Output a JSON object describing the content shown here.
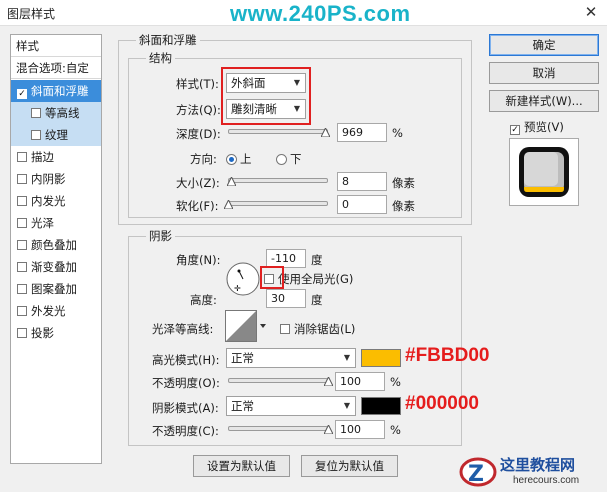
{
  "window": {
    "title": "图层样式",
    "watermark_top": "www.240PS.com",
    "close_glyph": "✕"
  },
  "left_panel": {
    "items": [
      {
        "label": "样式",
        "kind": "header"
      },
      {
        "label": "混合选项:自定",
        "kind": "header"
      },
      {
        "label": "斜面和浮雕",
        "checked": true,
        "kind": "selected"
      },
      {
        "label": "等高线",
        "checked": false,
        "kind": "sub"
      },
      {
        "label": "纹理",
        "checked": false,
        "kind": "sub"
      },
      {
        "label": "描边",
        "checked": false
      },
      {
        "label": "内阴影",
        "checked": false
      },
      {
        "label": "内发光",
        "checked": false
      },
      {
        "label": "光泽",
        "checked": false
      },
      {
        "label": "颜色叠加",
        "checked": false
      },
      {
        "label": "渐变叠加",
        "checked": false
      },
      {
        "label": "图案叠加",
        "checked": false
      },
      {
        "label": "外发光",
        "checked": false
      },
      {
        "label": "投影",
        "checked": false
      }
    ]
  },
  "bevel": {
    "section_title": "斜面和浮雕",
    "structure_title": "结构",
    "style_label": "样式(T):",
    "style_value": "外斜面",
    "technique_label": "方法(Q):",
    "technique_value": "雕刻清晰",
    "depth_label": "深度(D):",
    "depth_value": "969",
    "depth_unit": "%",
    "depth_fraction": 0.97,
    "direction_label": "方向:",
    "direction_up": "上",
    "direction_down": "下",
    "direction_selected": "上",
    "size_label": "大小(Z):",
    "size_value": "8",
    "size_unit": "像素",
    "size_fraction": 0.03,
    "soften_label": "软化(F):",
    "soften_value": "0",
    "soften_unit": "像素",
    "soften_fraction": 0.0
  },
  "shading": {
    "title": "阴影",
    "angle_label": "角度(N):",
    "angle_value": "-110",
    "angle_unit": "度",
    "global_light_label": "使用全局光(G)",
    "global_light_checked": false,
    "altitude_label": "高度:",
    "altitude_value": "30",
    "altitude_unit": "度",
    "gloss_contour_label": "光泽等高线:",
    "anti_alias_label": "消除锯齿(L)",
    "anti_alias_checked": false,
    "highlight_mode_label": "高光模式(H):",
    "highlight_mode_value": "正常",
    "highlight_color": "#FBBD00",
    "highlight_hex_label": "#FBBD00",
    "highlight_opacity_label": "不透明度(O):",
    "highlight_opacity_value": "100",
    "highlight_opacity_unit": "%",
    "highlight_opacity_fraction": 1.0,
    "shadow_mode_label": "阴影模式(A):",
    "shadow_mode_value": "正常",
    "shadow_color": "#000000",
    "shadow_hex_label": "#000000",
    "shadow_opacity_label": "不透明度(C):",
    "shadow_opacity_value": "100",
    "shadow_opacity_unit": "%",
    "shadow_opacity_fraction": 1.0
  },
  "bottom_buttons": {
    "make_default": "设置为默认值",
    "reset_default": "复位为默认值"
  },
  "right_buttons": {
    "ok": "确定",
    "cancel": "取消",
    "new_style": "新建样式(W)...",
    "preview_label": "预览(V)",
    "preview_checked": true
  },
  "watermark_bottom": {
    "title": "这里教程网",
    "url": "herecours.com"
  },
  "colors": {
    "accent_red": "#e02020",
    "selection_blue": "#3b8ddb",
    "sub_blue": "#c6def3",
    "watermark_cyan": "#19b3c9"
  }
}
